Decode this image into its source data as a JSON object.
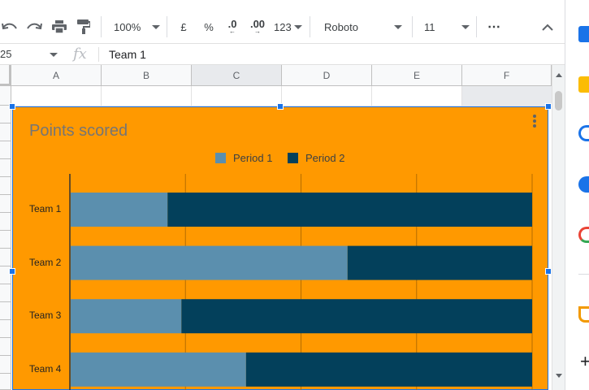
{
  "toolbar": {
    "zoom": "100%",
    "currency": "£",
    "percent": "%",
    "decrease_decimals": ".0",
    "increase_decimals": ".00",
    "more_formats": "123",
    "font": "Roboto",
    "font_size": "11",
    "more": "⋯"
  },
  "formula_bar": {
    "name_box": "25",
    "fx": "fx",
    "value": "Team 1"
  },
  "columns": [
    "A",
    "B",
    "C",
    "D",
    "E",
    "F"
  ],
  "colors": {
    "chart_background": "#ff9900",
    "period1": "#5b8fae",
    "period2": "#03405b",
    "selection": "#1a73e8"
  },
  "chart_data": {
    "type": "bar",
    "orientation": "horizontal",
    "stacked": "percent",
    "title": "Points scored",
    "categories": [
      "Team 1",
      "Team 2",
      "Team 3",
      "Team 4"
    ],
    "series": [
      {
        "name": "Period 1",
        "values": [
          21,
          60,
          24,
          38
        ]
      },
      {
        "name": "Period 2",
        "values": [
          79,
          40,
          76,
          62
        ]
      }
    ],
    "xlim": [
      0,
      100
    ],
    "grid": true,
    "legend": "top"
  }
}
